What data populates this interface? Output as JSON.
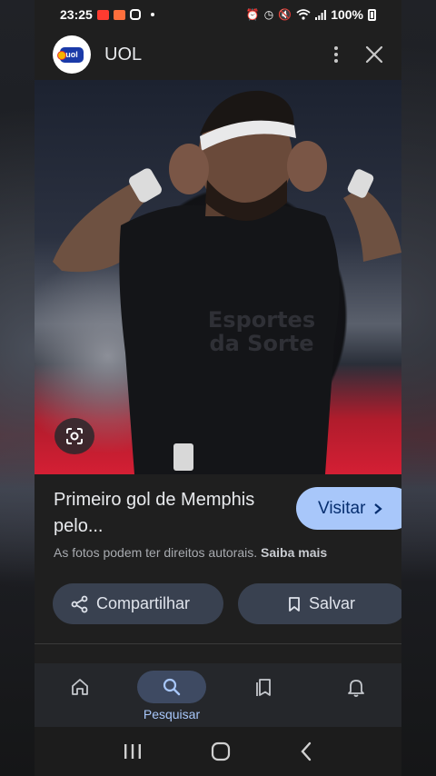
{
  "status_bar": {
    "time": "23:25",
    "battery": "100%",
    "notification_icons": [
      "youtube-icon",
      "app-icon",
      "instagram-icon",
      "dot-icon"
    ],
    "system_icons": [
      "alarm-icon",
      "clock-icon",
      "mute-icon",
      "wifi-icon",
      "signal-icon",
      "battery-icon"
    ]
  },
  "header": {
    "site_name": "UOL",
    "logo_text": "uol",
    "menu_icon": "more-vert-icon",
    "close_icon": "close-icon"
  },
  "image": {
    "lens_icon": "google-lens-icon",
    "jersey_text_line1": "Esportes",
    "jersey_text_line2": "da Sorte"
  },
  "result": {
    "title": "Primeiro gol de Memphis pelo...",
    "visit_label": "Visitar",
    "copyright_text": "As fotos podem ter direitos autorais.",
    "learn_more_label": "Saiba mais",
    "share_label": "Compartilhar",
    "save_label": "Salvar"
  },
  "bottom_nav": {
    "items": [
      {
        "name": "home",
        "icon": "home-icon",
        "label": ""
      },
      {
        "name": "search",
        "icon": "search-icon",
        "label": "Pesquisar",
        "active": true
      },
      {
        "name": "collections",
        "icon": "collections-icon",
        "label": ""
      },
      {
        "name": "notifications",
        "icon": "bell-icon",
        "label": ""
      }
    ]
  },
  "system_nav": [
    "recents-icon",
    "home-button-icon",
    "back-icon"
  ],
  "colors": {
    "accent": "#a8c7fa",
    "button_bg": "#394150",
    "nav_active_pill": "#3e4a62",
    "surface": "#1f1f1f"
  }
}
